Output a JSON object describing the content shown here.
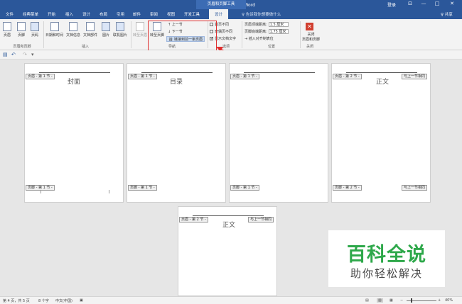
{
  "titlebar": {
    "title": "文档4 [兼容模式] - Word",
    "context_tab": "页眉和页脚工具",
    "login": "登录",
    "win_restore": "⊡",
    "win_min": "—",
    "win_max": "□",
    "win_close": "✕"
  },
  "tabs": [
    "文件",
    "经典菜单",
    "开始",
    "插入",
    "设计",
    "布局",
    "引用",
    "邮件",
    "审阅",
    "视图",
    "开发工具",
    "设计"
  ],
  "tell_me": "♀ 告诉我你想要做什么",
  "share": "♀ 共享",
  "ribbon": {
    "header": "页眉",
    "footer": "页脚",
    "page_number": "页码",
    "group_header_footer": "页眉和页脚",
    "date_time": "日期和时间",
    "doc_info": "文档信息",
    "doc_parts": "文档部件",
    "picture": "图片",
    "online_picture": "联机图片",
    "group_insert": "插入",
    "goto_header": "转至页眉",
    "goto_footer": "转至页脚",
    "prev": "上一节",
    "next": "下一节",
    "link_previous": "链接到前一条页眉",
    "group_nav": "导航",
    "first_diff": "首页不同",
    "oddeven_diff": "奇偶页不同",
    "show_doc_text": "显示文档文字",
    "group_options": "选项",
    "header_top": "页眉顶端距离:",
    "header_top_val": "1.5 厘米",
    "footer_bottom": "页脚底端距离:",
    "footer_bottom_val": "1.75 厘米",
    "insert_align_tab": "插入对齐制表位",
    "group_position": "位置",
    "close_hf_1": "关闭",
    "close_hf_2": "页眉和页脚",
    "group_close": "关闭"
  },
  "qat": {
    "save": "▤",
    "undo": "↶",
    "redo": "↷",
    "more": "▾"
  },
  "pages": [
    {
      "header_tag": "页眉 - 第 1 节 -",
      "title": "封面",
      "footer_tag": "页脚 - 第 1 节 -",
      "same_as_prev": ""
    },
    {
      "header_tag": "页眉 - 第 1 节 -",
      "title": "目录",
      "footer_tag": "页脚 - 第 1 节 -",
      "same_as_prev": ""
    },
    {
      "header_tag": "页眉 - 第 1 节 -",
      "title": "",
      "footer_tag": "页脚 - 第 1 节 -",
      "same_as_prev": ""
    },
    {
      "header_tag": "页眉 - 第 2 节 -",
      "title": "正文",
      "footer_tag": "页脚 - 第 2 节 -",
      "same_as_prev": "与上一节相同"
    },
    {
      "header_tag": "页眉 - 第 2 节 -",
      "title": "正文",
      "footer_tag": "",
      "same_as_prev": "与上一节相同"
    }
  ],
  "footer_same_as_prev": "与上一节相同",
  "status": {
    "page": "第 4 页，共 5 页",
    "words": "8 个字",
    "lang": "中文(中国)",
    "zoom": "40%"
  },
  "watermark": {
    "line1": "百科全说",
    "line2": "助你轻松解决"
  }
}
